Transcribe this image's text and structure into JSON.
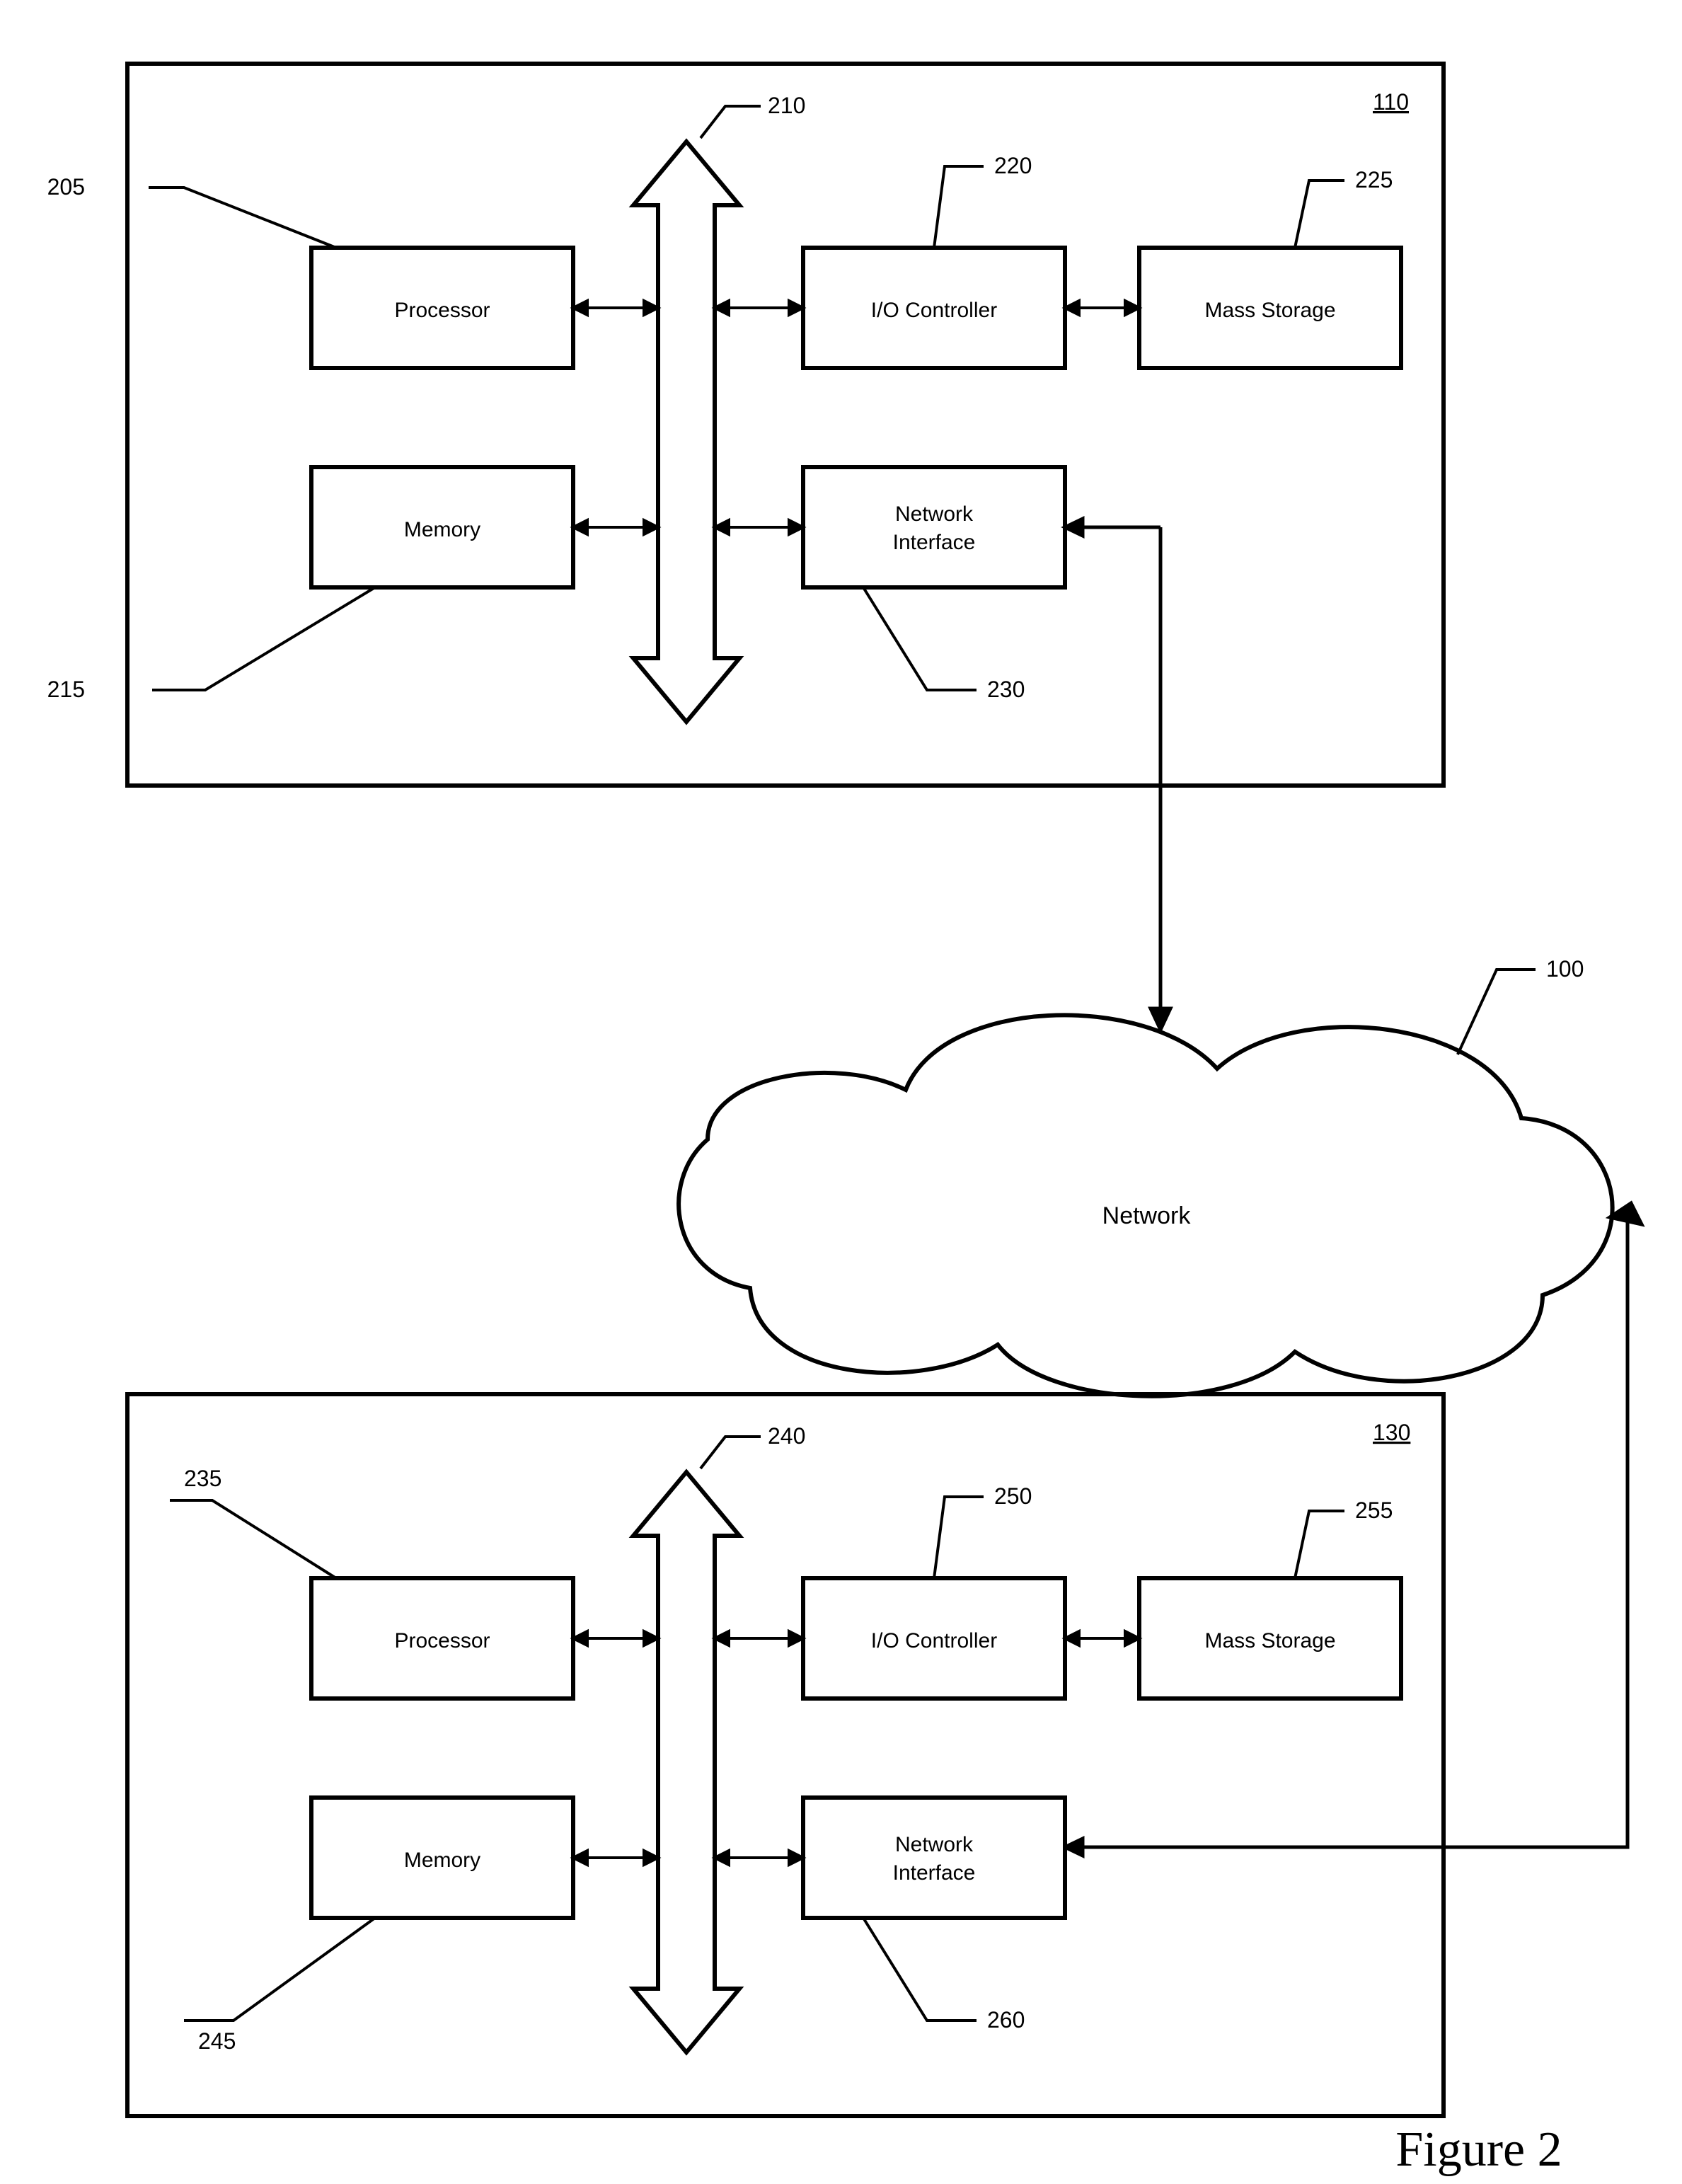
{
  "figure_caption": "Figure 2",
  "network": {
    "ref": "100",
    "label": "Network"
  },
  "systems": [
    {
      "id": "top",
      "ref": "110",
      "bus_ref": "210",
      "blocks": {
        "processor": {
          "ref": "205",
          "label": "Processor"
        },
        "memory": {
          "ref": "215",
          "label": "Memory"
        },
        "io_controller": {
          "ref": "220",
          "label": "I/O Controller"
        },
        "mass_storage": {
          "ref": "225",
          "label": "Mass Storage"
        },
        "network_interface": {
          "ref": "230",
          "label1": "Network",
          "label2": "Interface"
        }
      }
    },
    {
      "id": "bottom",
      "ref": "130",
      "bus_ref": "240",
      "blocks": {
        "processor": {
          "ref": "235",
          "label": "Processor"
        },
        "memory": {
          "ref": "245",
          "label": "Memory"
        },
        "io_controller": {
          "ref": "250",
          "label": "I/O Controller"
        },
        "mass_storage": {
          "ref": "255",
          "label": "Mass Storage"
        },
        "network_interface": {
          "ref": "260",
          "label1": "Network",
          "label2": "Interface"
        }
      }
    }
  ]
}
